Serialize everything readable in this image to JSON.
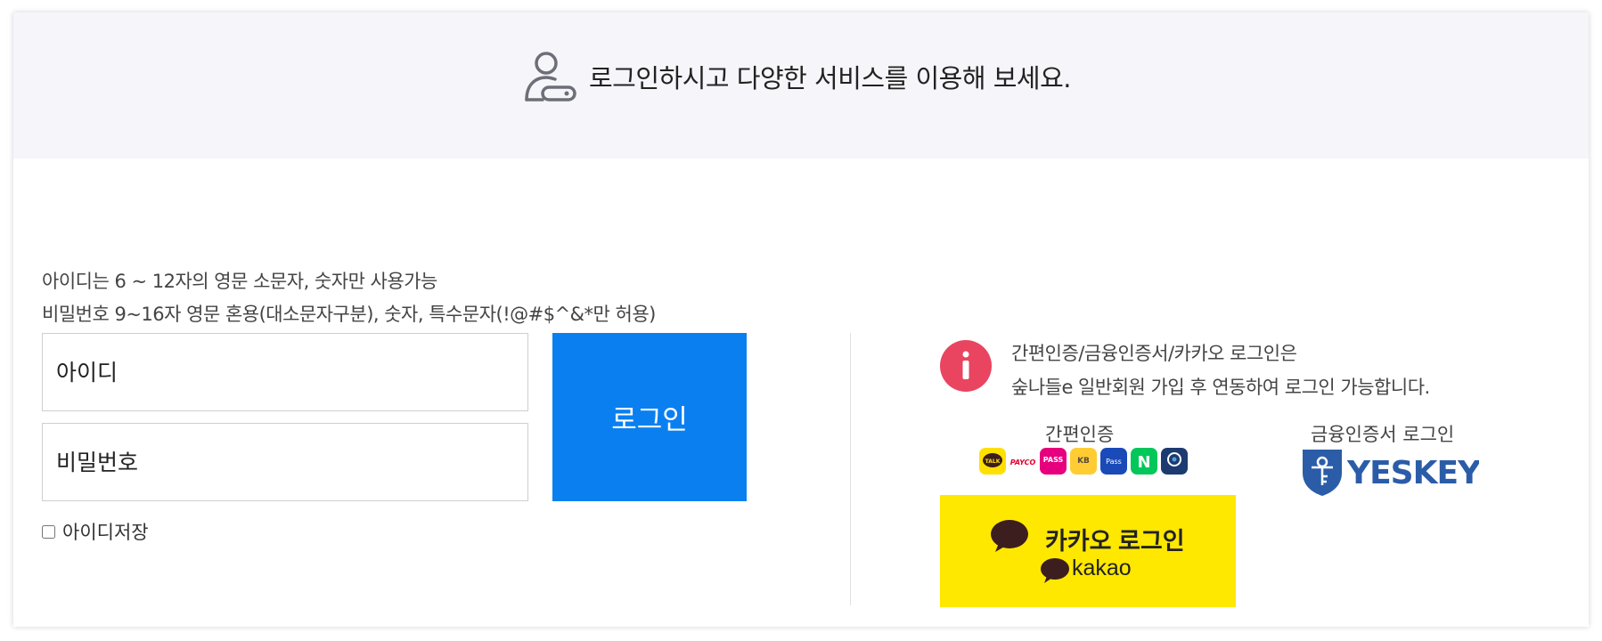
{
  "banner": {
    "text": "로그인하시고 다양한 서비스를 이용해 보세요.",
    "icon": "user-key-icon"
  },
  "guide": {
    "line1": "아이디는 6 ~ 12자의 영문 소문자, 숫자만 사용가능",
    "line2": "비밀번호 9~16자 영문 혼용(대소문자구분), 숫자, 특수문자(!@#$^&*만 허용)"
  },
  "form": {
    "id_placeholder": "아이디",
    "id_value": "",
    "pw_placeholder": "비밀번호",
    "pw_value": "",
    "login_label": "로그인",
    "save_id_label": "아이디저장",
    "save_id_checked": false
  },
  "info": {
    "icon": "info-icon",
    "line1": "간편인증/금융인증서/카카오 로그인은",
    "line2": "숲나들e 일반회원 가입 후 연동하여 로그인 가능합니다."
  },
  "simple_auth": {
    "label": "간편인증",
    "providers": [
      "TALK",
      "PAYCO",
      "PASS",
      "KB",
      "Pass",
      "N",
      "신한"
    ]
  },
  "cert": {
    "label": "금융인증서 로그인",
    "brand": "YESKEY"
  },
  "kakao": {
    "label": "카카오 로그인",
    "wordmark": "kakao"
  },
  "colors": {
    "login_button": "#0a80f0",
    "kakao_button": "#ffe800",
    "info_icon": "#e94560",
    "banner_bg": "#f5f5fa"
  }
}
